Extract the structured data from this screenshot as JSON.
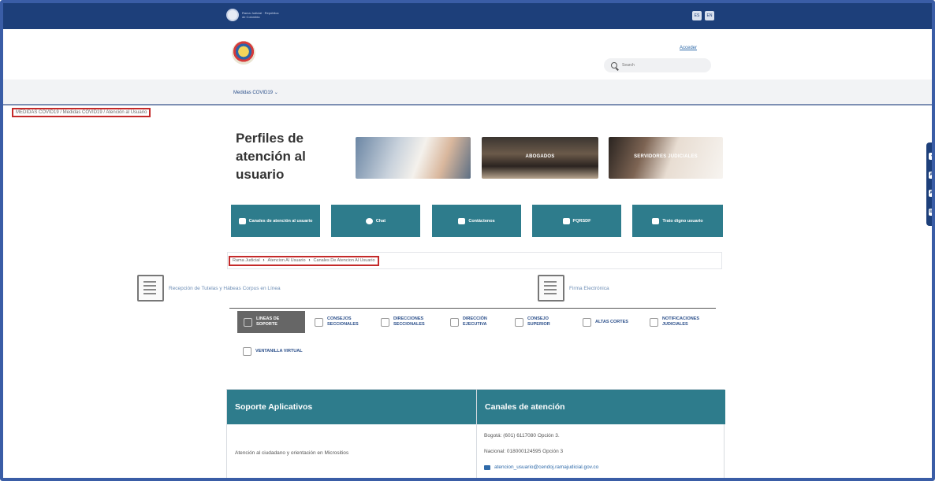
{
  "top_bar": {
    "gov_text": "Rama Judicial · República de Colombia",
    "lang": [
      "ES",
      "EN"
    ]
  },
  "header": {
    "acceder": "Acceder",
    "search_placeholder": "Search"
  },
  "nav": {
    "item": "Medidas COVID19"
  },
  "breadcrumb_top": "MEDIDAS COVID19 / Medidas COVID19 / Atención al Usuario",
  "title": "Perfiles de atención al usuario",
  "hero_images": [
    "",
    "ABOGADOS",
    "SERVIDORES JUDICIALES"
  ],
  "channel_buttons": [
    "Canales de atención al usuario",
    "Chat",
    "Contáctenos",
    "PQRSDF",
    "Trato digno usuario"
  ],
  "breadcrumb_main": {
    "items": [
      "Rama Judicial",
      "Atencion Al Usuario",
      "Canales De Atencion Al Usuario"
    ]
  },
  "links": {
    "tutelas": "Recepción de Tutelas y Hábeas Corpus en Línea",
    "firma": "Firma Electrónica"
  },
  "menu_tabs": [
    "LINEAS DE SOPORTE",
    "CONSEJOS SECCIONALES",
    "DIRECCIONES SECCIONALES",
    "DIRECCIÓN EJECUTIVA",
    "CONSEJO SUPERIOR",
    "ALTAS CORTES",
    "NOTIFICACIONES JUDICIALES",
    "VENTANILLA VIRTUAL"
  ],
  "table": {
    "headers": [
      "Soporte Aplicativos",
      "Canales de atención"
    ],
    "row1_col1": "Atención al ciudadano y orientación en Micrositios",
    "row1_col2": [
      "Bogotá: (601) 6117080 Opción 3.",
      "Nacional: 018000124595 Opción 3",
      "atencion_usuario@cendoj.ramajudicial.gov.co"
    ]
  },
  "a11y": [
    "◐",
    "A⁺",
    "A⁻",
    "⌨"
  ],
  "colors": {
    "primary": "#1d3f7a",
    "teal": "#2e7c8c",
    "highlight": "#c42a2a"
  }
}
